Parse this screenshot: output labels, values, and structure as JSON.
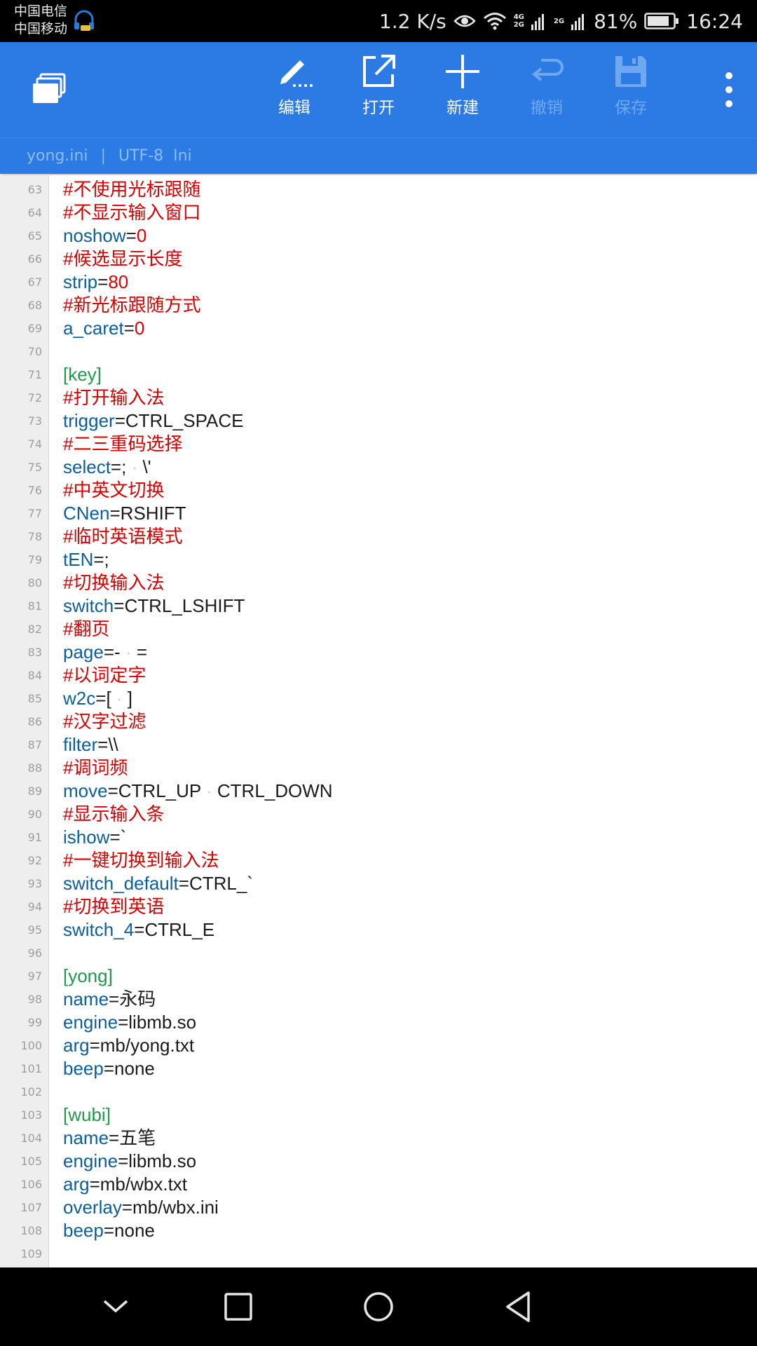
{
  "status_bar": {
    "carrier1": "中国电信",
    "carrier2": "中国移动",
    "net_speed": "1.2 K/s",
    "net_type_top": "4G",
    "net_type_bottom": "2G",
    "net_type2": "2G",
    "battery": "81%",
    "time": "16:24"
  },
  "toolbar": {
    "edit_label": "编辑",
    "open_label": "打开",
    "new_label": "新建",
    "undo_label": "撤销",
    "save_label": "保存"
  },
  "fileinfo": {
    "filename": "yong.ini",
    "separator": "|",
    "encoding": "UTF-8",
    "syntax": "Ini"
  },
  "colors": {
    "accent": "#2c7be5",
    "comment": "#d50000",
    "section": "#1f9a4a",
    "key": "#0b5e9e",
    "number": "#e00000"
  },
  "editor": {
    "lines": [
      {
        "n": "63",
        "kind": "comment",
        "text": "#不使用光标跟随"
      },
      {
        "n": "64",
        "kind": "comment",
        "text": "#不显示输入窗口"
      },
      {
        "n": "65",
        "kind": "kv",
        "key": "noshow",
        "value": "0",
        "num": true
      },
      {
        "n": "66",
        "kind": "comment",
        "text": "#候选显示长度"
      },
      {
        "n": "67",
        "kind": "kv",
        "key": "strip",
        "value": "80",
        "num": true
      },
      {
        "n": "68",
        "kind": "comment",
        "text": "#新光标跟随方式"
      },
      {
        "n": "69",
        "kind": "kv",
        "key": "a_caret",
        "value": "0",
        "num": true
      },
      {
        "n": "70",
        "kind": "blank"
      },
      {
        "n": "71",
        "kind": "section",
        "text": "[key]"
      },
      {
        "n": "72",
        "kind": "comment",
        "text": "#打开输入法"
      },
      {
        "n": "73",
        "kind": "kv",
        "key": "trigger",
        "value": "CTRL_SPACE"
      },
      {
        "n": "74",
        "kind": "comment",
        "text": "#二三重码选择"
      },
      {
        "n": "75",
        "kind": "kv",
        "key": "select",
        "parts": [
          ";",
          " · ",
          "\\'"
        ]
      },
      {
        "n": "76",
        "kind": "comment",
        "text": "#中英文切换"
      },
      {
        "n": "77",
        "kind": "kv",
        "key": "CNen",
        "value": "RSHIFT"
      },
      {
        "n": "78",
        "kind": "comment",
        "text": "#临时英语模式"
      },
      {
        "n": "79",
        "kind": "kv",
        "key": "tEN",
        "value": ";"
      },
      {
        "n": "80",
        "kind": "comment",
        "text": "#切换输入法"
      },
      {
        "n": "81",
        "kind": "kv",
        "key": "switch",
        "value": "CTRL_LSHIFT"
      },
      {
        "n": "82",
        "kind": "comment",
        "text": "#翻页"
      },
      {
        "n": "83",
        "kind": "kv",
        "key": "page",
        "parts": [
          "-",
          " · ",
          "="
        ]
      },
      {
        "n": "84",
        "kind": "comment",
        "text": "#以词定字"
      },
      {
        "n": "85",
        "kind": "kv",
        "key": "w2c",
        "parts": [
          "[",
          " · ",
          "]"
        ]
      },
      {
        "n": "86",
        "kind": "comment",
        "text": "#汉字过滤"
      },
      {
        "n": "87",
        "kind": "kv",
        "key": "filter",
        "value": "\\\\"
      },
      {
        "n": "88",
        "kind": "comment",
        "text": "#调词频"
      },
      {
        "n": "89",
        "kind": "kv",
        "key": "move",
        "parts": [
          "CTRL_UP",
          " · ",
          "CTRL_DOWN"
        ]
      },
      {
        "n": "90",
        "kind": "comment",
        "text": "#显示输入条"
      },
      {
        "n": "91",
        "kind": "kv",
        "key": "ishow",
        "value": "`"
      },
      {
        "n": "92",
        "kind": "comment",
        "text": "#一键切换到输入法"
      },
      {
        "n": "93",
        "kind": "kv",
        "key": "switch_default",
        "value": "CTRL_`"
      },
      {
        "n": "94",
        "kind": "comment",
        "text": "#切换到英语"
      },
      {
        "n": "95",
        "kind": "kv",
        "key": "switch_4",
        "value": "CTRL_E"
      },
      {
        "n": "96",
        "kind": "blank"
      },
      {
        "n": "97",
        "kind": "section",
        "text": "[yong]"
      },
      {
        "n": "98",
        "kind": "kv",
        "key": "name",
        "value": "永码"
      },
      {
        "n": "99",
        "kind": "kv",
        "key": "engine",
        "value": "libmb.so"
      },
      {
        "n": "100",
        "kind": "kv",
        "key": "arg",
        "value": "mb/yong.txt"
      },
      {
        "n": "101",
        "kind": "kv",
        "key": "beep",
        "value": "none"
      },
      {
        "n": "102",
        "kind": "blank"
      },
      {
        "n": "103",
        "kind": "section",
        "text": "[wubi]"
      },
      {
        "n": "104",
        "kind": "kv",
        "key": "name",
        "value": "五笔"
      },
      {
        "n": "105",
        "kind": "kv",
        "key": "engine",
        "value": "libmb.so"
      },
      {
        "n": "106",
        "kind": "kv",
        "key": "arg",
        "value": "mb/wbx.txt"
      },
      {
        "n": "107",
        "kind": "kv",
        "key": "overlay",
        "value": "mb/wbx.ini"
      },
      {
        "n": "108",
        "kind": "kv",
        "key": "beep",
        "value": "none"
      },
      {
        "n": "109",
        "kind": "blank"
      }
    ]
  }
}
